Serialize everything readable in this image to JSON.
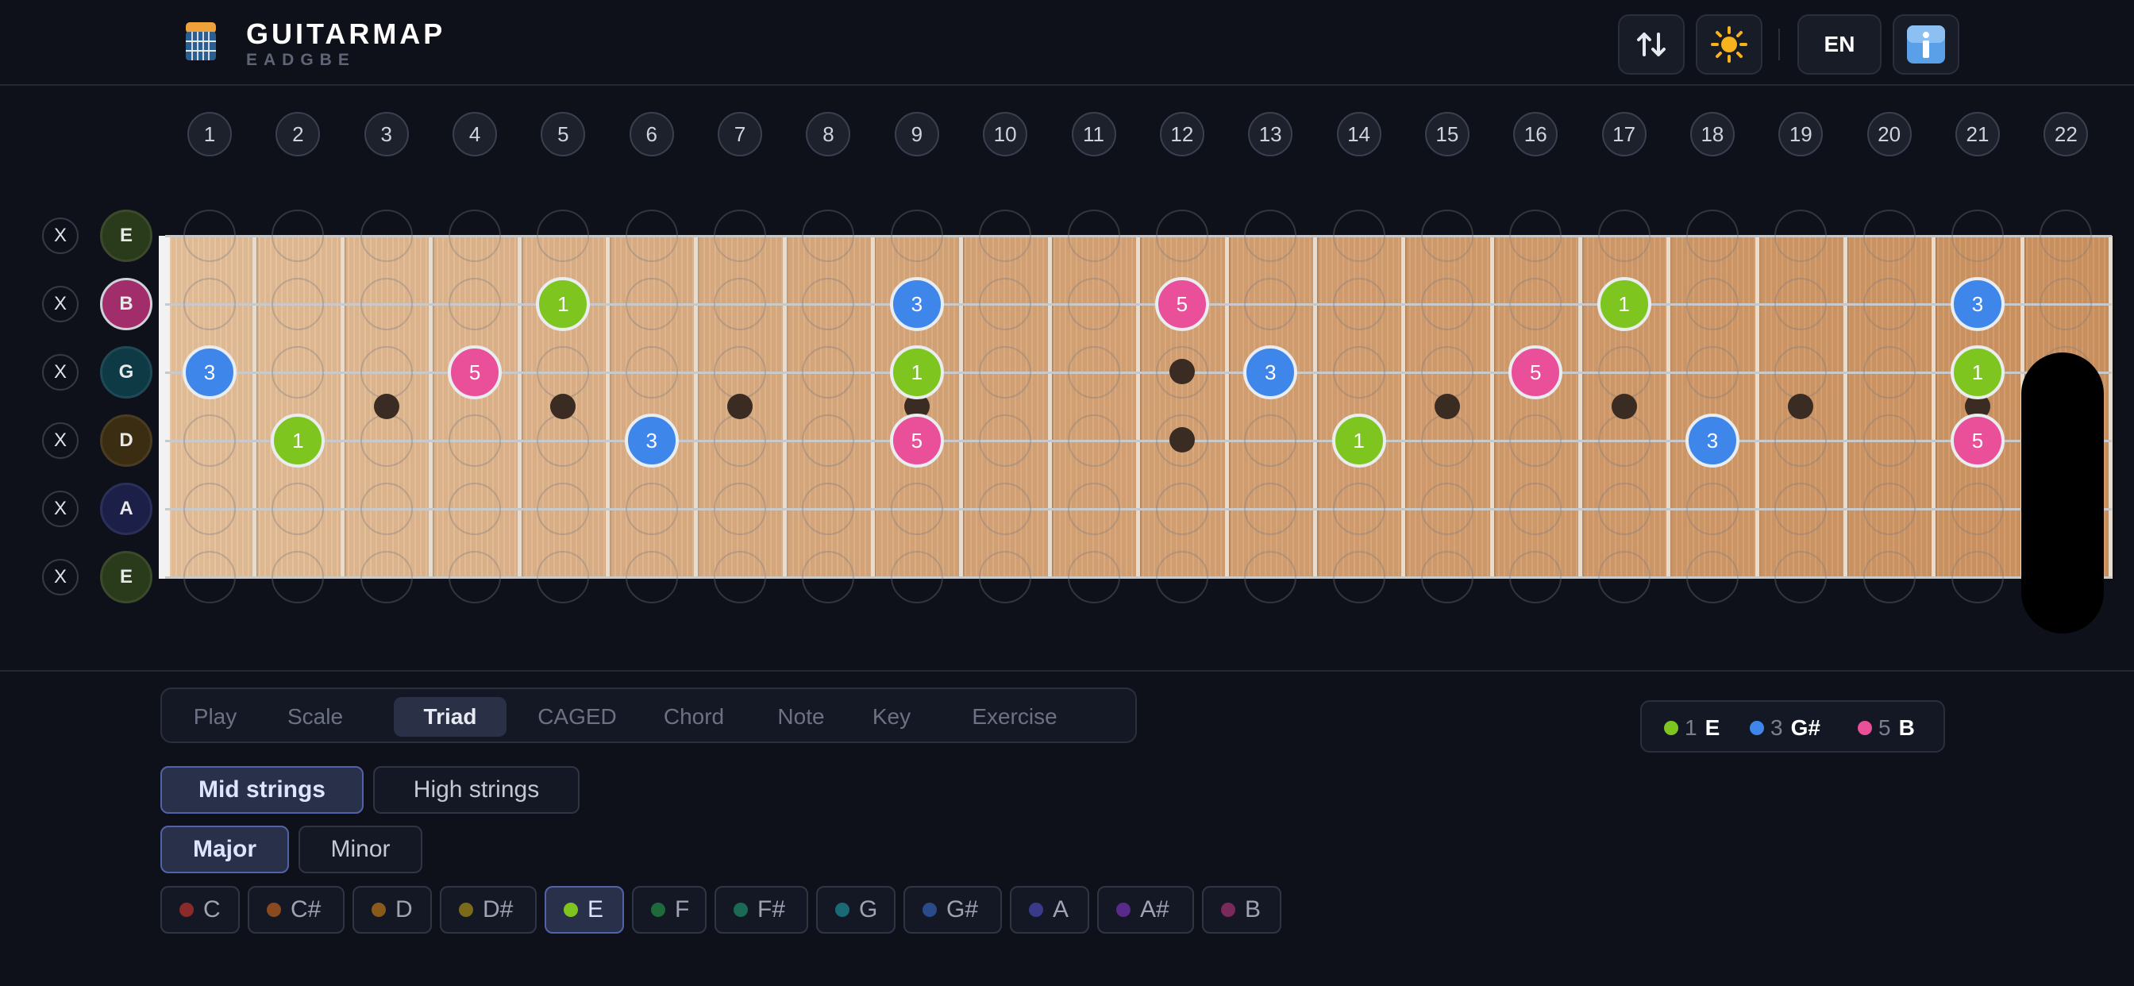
{
  "header": {
    "title": "GUITARMAP",
    "tuning": "EADGBE",
    "language": "EN",
    "icons": [
      "guitar-logo-icon",
      "swap-icon",
      "sun-icon",
      "info-icon"
    ]
  },
  "fret_numbers": [
    "1",
    "2",
    "3",
    "4",
    "5",
    "6",
    "7",
    "8",
    "9",
    "10",
    "11",
    "12",
    "13",
    "14",
    "15",
    "16",
    "17",
    "18",
    "19",
    "20",
    "21",
    "22"
  ],
  "strings": [
    {
      "mute": "X",
      "open": "E",
      "color": "#2a3b1c",
      "ring": "#3a4a2a"
    },
    {
      "mute": "X",
      "open": "B",
      "color": "#a12d6b",
      "ring": "#d0d0d8"
    },
    {
      "mute": "X",
      "open": "G",
      "color": "#0e3a45",
      "ring": "#1f4a55"
    },
    {
      "mute": "X",
      "open": "D",
      "color": "#3b2d12",
      "ring": "#4a3c22"
    },
    {
      "mute": "X",
      "open": "A",
      "color": "#1c1f48",
      "ring": "#2c2f58"
    },
    {
      "mute": "X",
      "open": "E",
      "color": "#2a3b1c",
      "ring": "#3a4a2a"
    }
  ],
  "fretboard_notes": [
    {
      "string": 2,
      "fret": 5,
      "degree": "1"
    },
    {
      "string": 2,
      "fret": 9,
      "degree": "3"
    },
    {
      "string": 2,
      "fret": 12,
      "degree": "5"
    },
    {
      "string": 2,
      "fret": 17,
      "degree": "1"
    },
    {
      "string": 2,
      "fret": 21,
      "degree": "3"
    },
    {
      "string": 3,
      "fret": 1,
      "degree": "3"
    },
    {
      "string": 3,
      "fret": 4,
      "degree": "5"
    },
    {
      "string": 3,
      "fret": 9,
      "degree": "1"
    },
    {
      "string": 3,
      "fret": 13,
      "degree": "3"
    },
    {
      "string": 3,
      "fret": 16,
      "degree": "5"
    },
    {
      "string": 3,
      "fret": 21,
      "degree": "1"
    },
    {
      "string": 4,
      "fret": 2,
      "degree": "1"
    },
    {
      "string": 4,
      "fret": 6,
      "degree": "3"
    },
    {
      "string": 4,
      "fret": 9,
      "degree": "5"
    },
    {
      "string": 4,
      "fret": 14,
      "degree": "1"
    },
    {
      "string": 4,
      "fret": 18,
      "degree": "3"
    },
    {
      "string": 4,
      "fret": 21,
      "degree": "5"
    }
  ],
  "degree_colors": {
    "1": "#7ec61f",
    "3": "#3f86ea",
    "5": "#ea4f9a"
  },
  "inlays": [
    3,
    5,
    7,
    9,
    15,
    17,
    19,
    21
  ],
  "double_inlay": 12,
  "modes": {
    "tabs": [
      "Play",
      "Scale",
      "Triad",
      "CAGED",
      "Chord",
      "Note",
      "Key",
      "Exercise"
    ],
    "active": "Triad"
  },
  "legend": [
    {
      "degree": "1",
      "note": "E",
      "color": "#7ec61f"
    },
    {
      "degree": "3",
      "note": "G#",
      "color": "#3f86ea"
    },
    {
      "degree": "5",
      "note": "B",
      "color": "#ea4f9a"
    }
  ],
  "string_sets": {
    "options": [
      "Mid strings",
      "High strings"
    ],
    "active": "Mid strings"
  },
  "quality": {
    "options": [
      "Major",
      "Minor"
    ],
    "active": "Major"
  },
  "keys": {
    "options": [
      {
        "label": "C",
        "color": "#8a2a2a"
      },
      {
        "label": "C#",
        "color": "#8a4a1f"
      },
      {
        "label": "D",
        "color": "#8a5a1a"
      },
      {
        "label": "D#",
        "color": "#7a6a1a"
      },
      {
        "label": "E",
        "color": "#7ec61f"
      },
      {
        "label": "F",
        "color": "#1f6a3a"
      },
      {
        "label": "F#",
        "color": "#1a6a55"
      },
      {
        "label": "G",
        "color": "#1a6a75"
      },
      {
        "label": "G#",
        "color": "#2a4a8a"
      },
      {
        "label": "A",
        "color": "#3a3a8a"
      },
      {
        "label": "A#",
        "color": "#5a2a8a"
      },
      {
        "label": "B",
        "color": "#7a2a5a"
      }
    ],
    "active": "E"
  }
}
